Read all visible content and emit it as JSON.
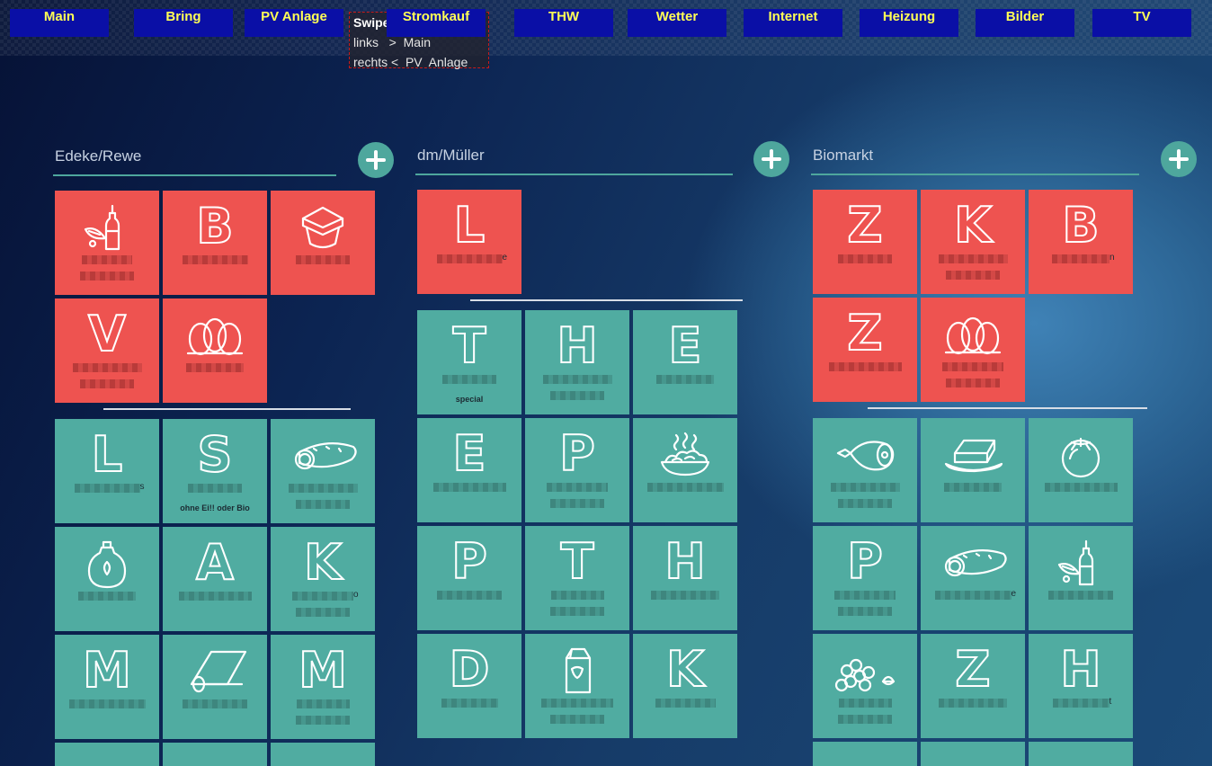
{
  "nav": [
    {
      "label": "Main"
    },
    {
      "label": "Bring"
    },
    {
      "label": "PV Anlage"
    },
    {
      "label": "Stromkauf"
    },
    {
      "label": "THW"
    },
    {
      "label": "Wetter"
    },
    {
      "label": "Internet"
    },
    {
      "label": "Heizung"
    },
    {
      "label": "Bilder"
    },
    {
      "label": "TV"
    }
  ],
  "swipe": {
    "title": "Swipe",
    "line1": "links   >  Main",
    "line2": "rechts <  PV  Anlage"
  },
  "columns": [
    {
      "title": "Edeke/Rewe",
      "pending": [
        {
          "icon": "oil-bottle-icon"
        },
        {
          "letter": "B"
        },
        {
          "icon": "yogurt-cup-icon"
        },
        {
          "letter": "V"
        },
        {
          "icon": "eggs-icon"
        }
      ],
      "done": [
        {
          "letter": "L",
          "tail": "s"
        },
        {
          "letter": "S",
          "note": "ohne Ei!! oder Bio"
        },
        {
          "icon": "cucumber-icon"
        },
        {
          "icon": "syrup-bottle-icon"
        },
        {
          "letter": "A"
        },
        {
          "letter": "K",
          "tail": "o"
        },
        {
          "letter": "M"
        },
        {
          "icon": "foil-roll-icon"
        },
        {
          "letter": "M"
        }
      ]
    },
    {
      "title": "dm/Müller",
      "pending": [
        {
          "letter": "L",
          "tail": "e"
        }
      ],
      "done": [
        {
          "letter": "T",
          "note": "special"
        },
        {
          "letter": "H"
        },
        {
          "letter": "E"
        },
        {
          "letter": "E"
        },
        {
          "letter": "P"
        },
        {
          "icon": "pasta-bowl-icon"
        },
        {
          "letter": "P"
        },
        {
          "letter": "T"
        },
        {
          "letter": "H"
        },
        {
          "letter": "D"
        },
        {
          "icon": "milk-carton-icon"
        },
        {
          "letter": "K"
        }
      ]
    },
    {
      "title": "Biomarkt",
      "pending": [
        {
          "letter": "Z"
        },
        {
          "letter": "K"
        },
        {
          "letter": "B",
          "tail": "n"
        },
        {
          "letter": "Z"
        },
        {
          "icon": "eggs-icon"
        }
      ],
      "done": [
        {
          "icon": "ham-icon"
        },
        {
          "icon": "butter-icon"
        },
        {
          "icon": "tomato-icon"
        },
        {
          "letter": "P"
        },
        {
          "icon": "cucumber-icon",
          "tail": "e"
        },
        {
          "icon": "oil-bottle-icon"
        },
        {
          "icon": "nuts-icon"
        },
        {
          "letter": "Z"
        },
        {
          "letter": "H",
          "tail": "t"
        }
      ]
    }
  ],
  "colors": {
    "pending": "#ee5350",
    "done": "#50aca1",
    "nav_bg": "#0a0fa6",
    "nav_text": "#ffff55"
  }
}
